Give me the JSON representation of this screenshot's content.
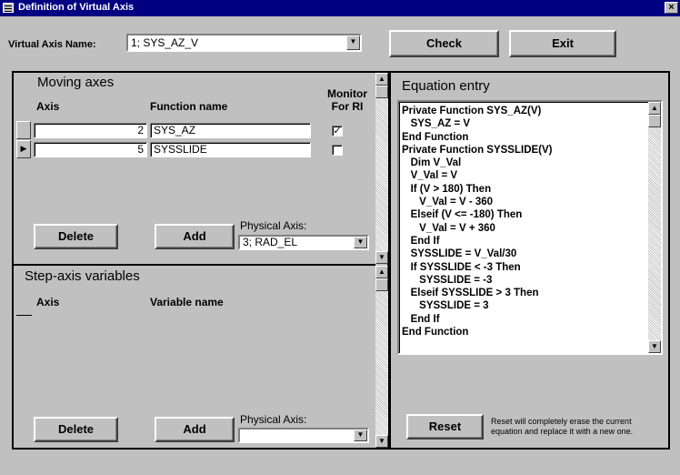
{
  "window": {
    "title": "Definition of Virtual Axis",
    "close_label": "×"
  },
  "header": {
    "virtual_axis_label": "Virtual Axis Name:",
    "virtual_axis_value": "1; SYS_AZ_V",
    "check_label": "Check",
    "exit_label": "Exit"
  },
  "moving_axes": {
    "title": "Moving axes",
    "col_axis": "Axis",
    "col_function": "Function name",
    "col_monitor_1": "Monitor",
    "col_monitor_2": "For RI",
    "rows": [
      {
        "axis": "2",
        "function": "SYS_AZ",
        "monitor": true
      },
      {
        "axis": "5",
        "function": "SYSSLIDE",
        "monitor": false
      }
    ],
    "delete_label": "Delete",
    "add_label": "Add",
    "physical_axis_label": "Physical Axis:",
    "physical_axis_value": "3; RAD_EL"
  },
  "step_axis": {
    "title": "Step-axis variables",
    "col_axis": "Axis",
    "col_variable": "Variable name",
    "delete_label": "Delete",
    "add_label": "Add",
    "physical_axis_label": "Physical Axis:",
    "physical_axis_value": ""
  },
  "equation": {
    "title": "Equation entry",
    "lines": [
      "Private Function SYS_AZ(V)",
      "   SYS_AZ = V",
      "End Function",
      "Private Function SYSSLIDE(V)",
      "   Dim V_Val",
      "   V_Val = V",
      "   If (V > 180) Then",
      "      V_Val = V - 360",
      "   Elseif (V <= -180) Then",
      "      V_Val = V + 360",
      "   End If",
      "   SYSSLIDE = V_Val/30",
      "   If SYSSLIDE < -3 Then",
      "      SYSSLIDE = -3",
      "   Elseif SYSSLIDE > 3 Then",
      "      SYSSLIDE = 3",
      "   End If",
      "End Function"
    ],
    "reset_label": "Reset",
    "reset_note_1": "Reset will completely erase the current",
    "reset_note_2": "equation and replace it with a new one."
  },
  "icons": [
    "window-menu-icon",
    "close-icon",
    "dropdown-arrow-icon",
    "record-selector-arrow-icon",
    "check-mark-icon",
    "scroll-up-icon",
    "scroll-down-icon"
  ]
}
